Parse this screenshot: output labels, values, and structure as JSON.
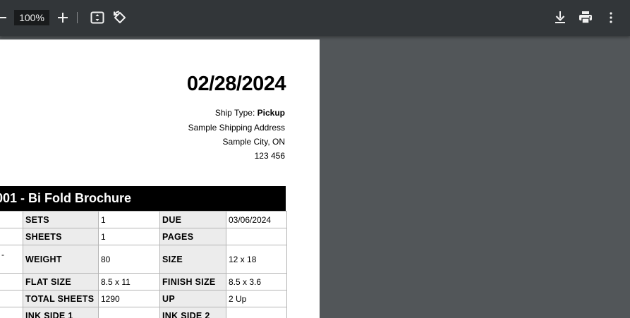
{
  "toolbar": {
    "zoom_value": "100%",
    "icons": [
      "zoom-out-icon",
      "zoom-in-icon",
      "fit-to-page-icon",
      "rotate-icon",
      "download-icon",
      "print-icon",
      "more-options-icon"
    ]
  },
  "document": {
    "date": "02/28/2024",
    "ship_type_label": "Ship Type: ",
    "ship_type_value": "Pickup",
    "address_line1": "Sample Shipping Address",
    "address_line2": "Sample City, ON",
    "address_line3": "123 456",
    "job_title": "001 - Bi Fold Brochure",
    "left_fragment": "-",
    "rows": [
      {
        "label1": "SETS",
        "value1": "1",
        "label2": "DUE",
        "value2": "03/06/2024"
      },
      {
        "label1": "SHEETS",
        "value1": "1",
        "label2": "PAGES",
        "value2": ""
      },
      {
        "label1": "WEIGHT",
        "value1": "80",
        "label2": "SIZE",
        "value2": "12 x 18"
      },
      {
        "label1": "FLAT SIZE",
        "value1": "8.5 x 11",
        "label2": "FINISH SIZE",
        "value2": "8.5 x 3.6"
      },
      {
        "label1": "TOTAL SHEETS",
        "value1": "1290",
        "label2": "UP",
        "value2": "2 Up"
      },
      {
        "label1": "INK SIDE 1",
        "value1": "",
        "label2": "INK SIDE 2",
        "value2": ""
      }
    ]
  },
  "colors": {
    "toolbar_bg": "#323639",
    "viewer_bg": "#525659",
    "label_cell_bg": "#ececec",
    "header_bar_bg": "#000000"
  }
}
